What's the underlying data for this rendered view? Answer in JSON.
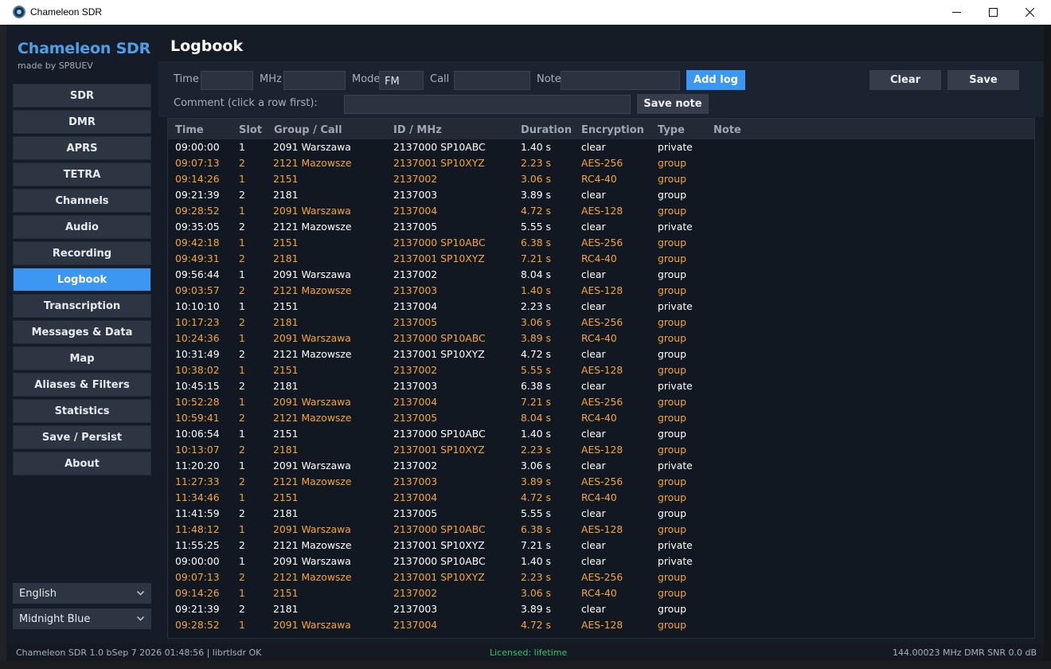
{
  "window": {
    "title": "Chameleon SDR"
  },
  "sidebar": {
    "brand": "Chameleon SDR",
    "subtitle": "made by SP8UEV",
    "items": [
      {
        "label": "SDR",
        "active": false
      },
      {
        "label": "DMR",
        "active": false
      },
      {
        "label": "APRS",
        "active": false
      },
      {
        "label": "TETRA",
        "active": false
      },
      {
        "label": "Channels",
        "active": false
      },
      {
        "label": "Audio",
        "active": false
      },
      {
        "label": "Recording",
        "active": false
      },
      {
        "label": "Logbook",
        "active": true
      },
      {
        "label": "Transcription",
        "active": false
      },
      {
        "label": "Messages & Data",
        "active": false
      },
      {
        "label": "Map",
        "active": false
      },
      {
        "label": "Aliases & Filters",
        "active": false
      },
      {
        "label": "Statistics",
        "active": false
      },
      {
        "label": "Save / Persist",
        "active": false
      },
      {
        "label": "About",
        "active": false
      }
    ],
    "language": "English",
    "theme": "Midnight Blue"
  },
  "page": {
    "title": "Logbook"
  },
  "form": {
    "time_label": "Time",
    "time_value": "",
    "mhz_label": "MHz",
    "mhz_value": "",
    "mode_label": "Mode",
    "mode_value": "FM",
    "call_label": "Call",
    "call_value": "",
    "note_label": "Note",
    "note_value": "",
    "add_log": "Add log",
    "clear": "Clear",
    "save": "Save",
    "comment_label": "Comment (click a row first):",
    "comment_value": "",
    "save_note": "Save note"
  },
  "table": {
    "columns": [
      "Time",
      "Slot",
      "Group / Call",
      "ID / MHz",
      "Duration",
      "Encryption",
      "Type",
      "Note"
    ],
    "rows": [
      {
        "time": "09:00:00",
        "slot": "1",
        "group": "2091  Warszawa",
        "id": "2137000  SP10ABC",
        "dur": "1.40 s",
        "enc": "clear",
        "type": "private",
        "note": "",
        "hl": false
      },
      {
        "time": "09:07:13",
        "slot": "2",
        "group": "2121  Mazowsze",
        "id": "2137001  SP10XYZ",
        "dur": "2.23 s",
        "enc": "AES-256",
        "type": "group",
        "note": "",
        "hl": true
      },
      {
        "time": "09:14:26",
        "slot": "1",
        "group": "2151",
        "id": "2137002",
        "dur": "3.06 s",
        "enc": "RC4-40",
        "type": "group",
        "note": "",
        "hl": true
      },
      {
        "time": "09:21:39",
        "slot": "2",
        "group": "2181",
        "id": "2137003",
        "dur": "3.89 s",
        "enc": "clear",
        "type": "group",
        "note": "",
        "hl": false
      },
      {
        "time": "09:28:52",
        "slot": "1",
        "group": "2091  Warszawa",
        "id": "2137004",
        "dur": "4.72 s",
        "enc": "AES-128",
        "type": "group",
        "note": "",
        "hl": true
      },
      {
        "time": "09:35:05",
        "slot": "2",
        "group": "2121  Mazowsze",
        "id": "2137005",
        "dur": "5.55 s",
        "enc": "clear",
        "type": "private",
        "note": "",
        "hl": false
      },
      {
        "time": "09:42:18",
        "slot": "1",
        "group": "2151",
        "id": "2137000  SP10ABC",
        "dur": "6.38 s",
        "enc": "AES-256",
        "type": "group",
        "note": "",
        "hl": true
      },
      {
        "time": "09:49:31",
        "slot": "2",
        "group": "2181",
        "id": "2137001  SP10XYZ",
        "dur": "7.21 s",
        "enc": "RC4-40",
        "type": "group",
        "note": "",
        "hl": true
      },
      {
        "time": "09:56:44",
        "slot": "1",
        "group": "2091  Warszawa",
        "id": "2137002",
        "dur": "8.04 s",
        "enc": "clear",
        "type": "group",
        "note": "",
        "hl": false
      },
      {
        "time": "09:03:57",
        "slot": "2",
        "group": "2121  Mazowsze",
        "id": "2137003",
        "dur": "1.40 s",
        "enc": "AES-128",
        "type": "group",
        "note": "",
        "hl": true
      },
      {
        "time": "10:10:10",
        "slot": "1",
        "group": "2151",
        "id": "2137004",
        "dur": "2.23 s",
        "enc": "clear",
        "type": "private",
        "note": "",
        "hl": false
      },
      {
        "time": "10:17:23",
        "slot": "2",
        "group": "2181",
        "id": "2137005",
        "dur": "3.06 s",
        "enc": "AES-256",
        "type": "group",
        "note": "",
        "hl": true
      },
      {
        "time": "10:24:36",
        "slot": "1",
        "group": "2091  Warszawa",
        "id": "2137000  SP10ABC",
        "dur": "3.89 s",
        "enc": "RC4-40",
        "type": "group",
        "note": "",
        "hl": true
      },
      {
        "time": "10:31:49",
        "slot": "2",
        "group": "2121  Mazowsze",
        "id": "2137001  SP10XYZ",
        "dur": "4.72 s",
        "enc": "clear",
        "type": "group",
        "note": "",
        "hl": false
      },
      {
        "time": "10:38:02",
        "slot": "1",
        "group": "2151",
        "id": "2137002",
        "dur": "5.55 s",
        "enc": "AES-128",
        "type": "group",
        "note": "",
        "hl": true
      },
      {
        "time": "10:45:15",
        "slot": "2",
        "group": "2181",
        "id": "2137003",
        "dur": "6.38 s",
        "enc": "clear",
        "type": "private",
        "note": "",
        "hl": false
      },
      {
        "time": "10:52:28",
        "slot": "1",
        "group": "2091  Warszawa",
        "id": "2137004",
        "dur": "7.21 s",
        "enc": "AES-256",
        "type": "group",
        "note": "",
        "hl": true
      },
      {
        "time": "10:59:41",
        "slot": "2",
        "group": "2121  Mazowsze",
        "id": "2137005",
        "dur": "8.04 s",
        "enc": "RC4-40",
        "type": "group",
        "note": "",
        "hl": true
      },
      {
        "time": "10:06:54",
        "slot": "1",
        "group": "2151",
        "id": "2137000  SP10ABC",
        "dur": "1.40 s",
        "enc": "clear",
        "type": "group",
        "note": "",
        "hl": false
      },
      {
        "time": "10:13:07",
        "slot": "2",
        "group": "2181",
        "id": "2137001  SP10XYZ",
        "dur": "2.23 s",
        "enc": "AES-128",
        "type": "group",
        "note": "",
        "hl": true
      },
      {
        "time": "11:20:20",
        "slot": "1",
        "group": "2091  Warszawa",
        "id": "2137002",
        "dur": "3.06 s",
        "enc": "clear",
        "type": "private",
        "note": "",
        "hl": false
      },
      {
        "time": "11:27:33",
        "slot": "2",
        "group": "2121  Mazowsze",
        "id": "2137003",
        "dur": "3.89 s",
        "enc": "AES-256",
        "type": "group",
        "note": "",
        "hl": true
      },
      {
        "time": "11:34:46",
        "slot": "1",
        "group": "2151",
        "id": "2137004",
        "dur": "4.72 s",
        "enc": "RC4-40",
        "type": "group",
        "note": "",
        "hl": true
      },
      {
        "time": "11:41:59",
        "slot": "2",
        "group": "2181",
        "id": "2137005",
        "dur": "5.55 s",
        "enc": "clear",
        "type": "group",
        "note": "",
        "hl": false
      },
      {
        "time": "11:48:12",
        "slot": "1",
        "group": "2091  Warszawa",
        "id": "2137000  SP10ABC",
        "dur": "6.38 s",
        "enc": "AES-128",
        "type": "group",
        "note": "",
        "hl": true
      },
      {
        "time": "11:55:25",
        "slot": "2",
        "group": "2121  Mazowsze",
        "id": "2137001  SP10XYZ",
        "dur": "7.21 s",
        "enc": "clear",
        "type": "private",
        "note": "",
        "hl": false
      },
      {
        "time": "09:00:00",
        "slot": "1",
        "group": "2091  Warszawa",
        "id": "2137000  SP10ABC",
        "dur": "1.40 s",
        "enc": "clear",
        "type": "private",
        "note": "",
        "hl": false
      },
      {
        "time": "09:07:13",
        "slot": "2",
        "group": "2121  Mazowsze",
        "id": "2137001  SP10XYZ",
        "dur": "2.23 s",
        "enc": "AES-256",
        "type": "group",
        "note": "",
        "hl": true
      },
      {
        "time": "09:14:26",
        "slot": "1",
        "group": "2151",
        "id": "2137002",
        "dur": "3.06 s",
        "enc": "RC4-40",
        "type": "group",
        "note": "",
        "hl": true
      },
      {
        "time": "09:21:39",
        "slot": "2",
        "group": "2181",
        "id": "2137003",
        "dur": "3.89 s",
        "enc": "clear",
        "type": "group",
        "note": "",
        "hl": false
      },
      {
        "time": "09:28:52",
        "slot": "1",
        "group": "2091  Warszawa",
        "id": "2137004",
        "dur": "4.72 s",
        "enc": "AES-128",
        "type": "group",
        "note": "",
        "hl": true
      }
    ]
  },
  "status": {
    "left": "Chameleon SDR 1.0  bSep  7 2026 01:48:56  |  librtlsdr OK",
    "middle": "Licensed: lifetime",
    "right": "144.00023 MHz  DMR  SNR 0.0 dB"
  },
  "colors": {
    "accent": "#3b97f2",
    "brand": "#4d9fea",
    "highlight_row": "#f4a636",
    "license_ok": "#2fc76a",
    "sidebar_bg": "#151c27",
    "main_bg": "#161c26"
  }
}
